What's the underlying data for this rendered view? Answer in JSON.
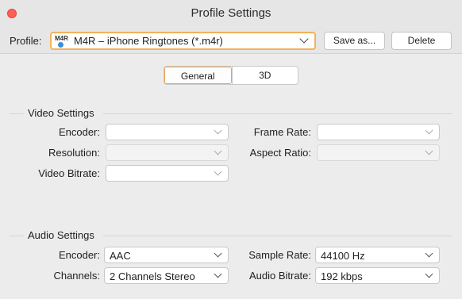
{
  "window": {
    "title": "Profile Settings"
  },
  "profile": {
    "label": "Profile:",
    "icon_text": "M4R",
    "selected": "M4R – iPhone Ringtones (*.m4r)",
    "save_as_label": "Save as...",
    "delete_label": "Delete"
  },
  "tabs": [
    {
      "label": "General",
      "active": true
    },
    {
      "label": "3D",
      "active": false
    }
  ],
  "video": {
    "title": "Video Settings",
    "encoder_label": "Encoder:",
    "encoder_value": "",
    "resolution_label": "Resolution:",
    "resolution_value": "",
    "bitrate_label": "Video Bitrate:",
    "bitrate_value": "",
    "frame_rate_label": "Frame Rate:",
    "frame_rate_value": "",
    "aspect_ratio_label": "Aspect Ratio:",
    "aspect_ratio_value": ""
  },
  "audio": {
    "title": "Audio Settings",
    "encoder_label": "Encoder:",
    "encoder_value": "AAC",
    "channels_label": "Channels:",
    "channels_value": "2 Channels Stereo",
    "sample_rate_label": "Sample Rate:",
    "sample_rate_value": "44100 Hz",
    "bitrate_label": "Audio Bitrate:",
    "bitrate_value": "192 kbps"
  },
  "colors": {
    "close_button": "#fe5f57",
    "focus_accent": "#f0a24a"
  }
}
